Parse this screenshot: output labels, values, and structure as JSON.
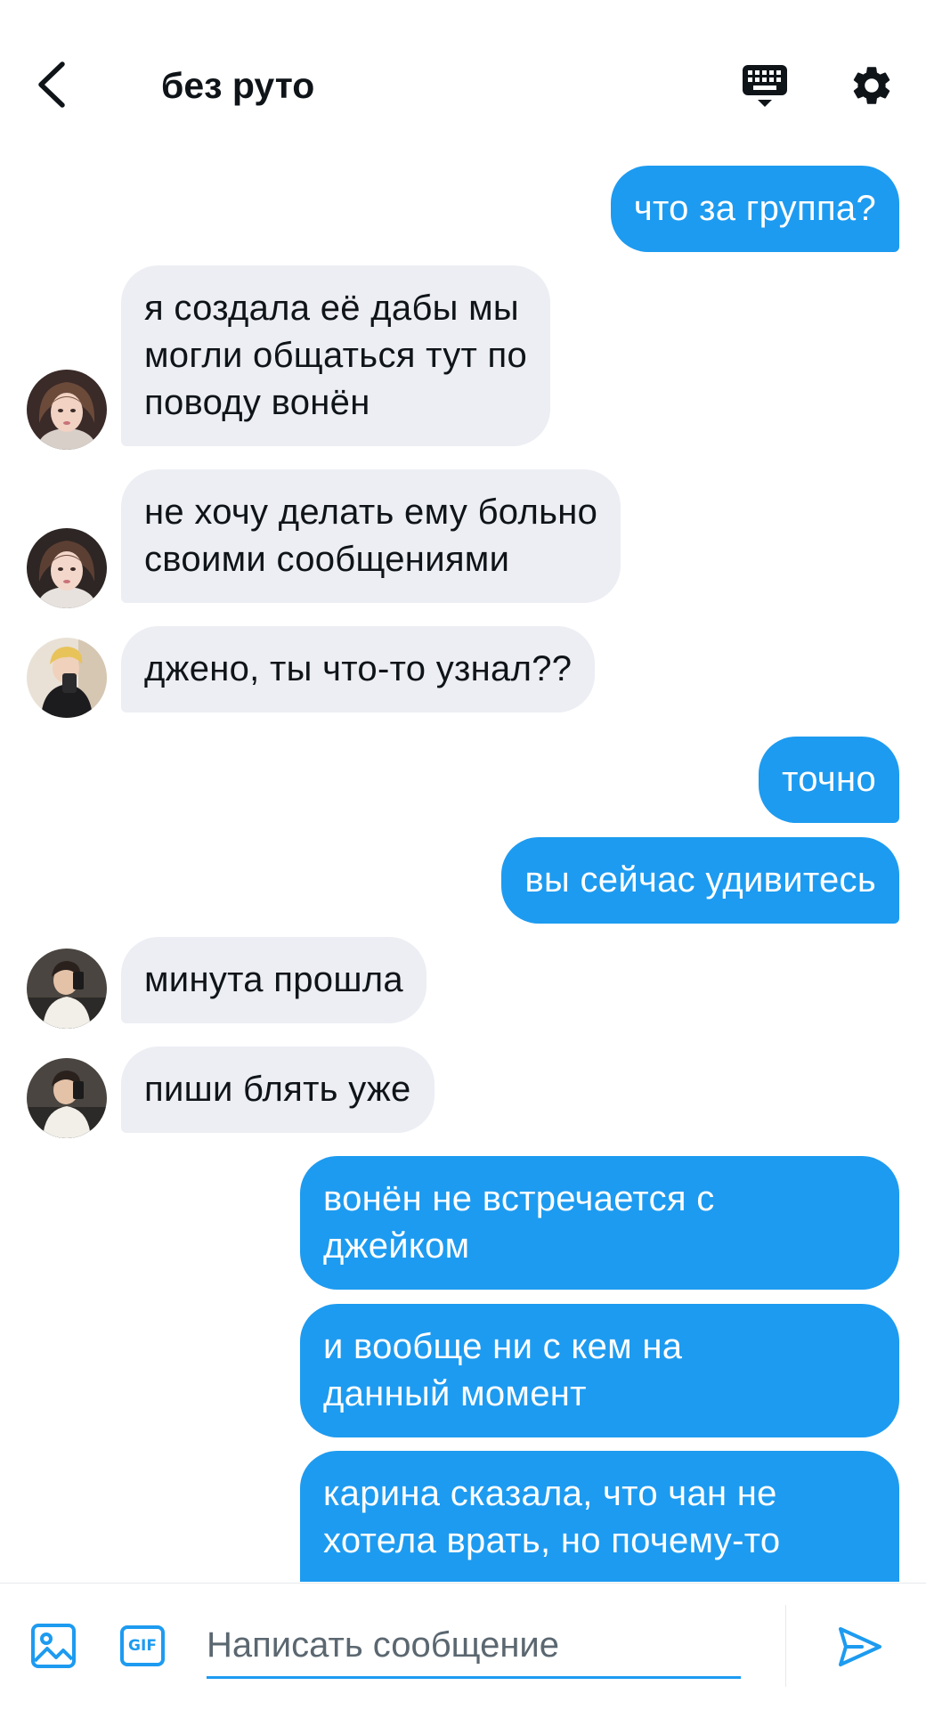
{
  "header": {
    "title": "без руто",
    "back_icon": "chevron-left-icon",
    "keyboard_icon": "keyboard-icon",
    "settings_icon": "gear-icon"
  },
  "messages": [
    {
      "direction": "out",
      "text": "что за группа?"
    },
    {
      "direction": "in",
      "text": "я создала её дабы мы\nмогли общаться тут по\nповоду вонён"
    },
    {
      "direction": "in",
      "text": "не хочу делать ему больно\nсвоими сообщениями"
    },
    {
      "direction": "in",
      "text": "джено, ты что-то узнал??"
    },
    {
      "direction": "out",
      "text": "точно"
    },
    {
      "direction": "out",
      "text": "вы сейчас удивитесь"
    },
    {
      "direction": "in",
      "text": "минута прошла"
    },
    {
      "direction": "in",
      "text": "пиши блять уже"
    },
    {
      "direction": "out",
      "text": "вонён не встречается с\nджейком"
    },
    {
      "direction": "out",
      "text": "и вообще ни с кем на\nданный момент"
    },
    {
      "direction": "out",
      "text": "карина сказала, что чан не\nхотела врать, но почему-то"
    }
  ],
  "composer": {
    "placeholder": "Написать сообщение",
    "value": "",
    "media_icon": "image-icon",
    "gif_label": "GIF",
    "send_icon": "send-icon"
  },
  "colors": {
    "accent": "#1d9bf0",
    "incoming_bubble": "#eceef3",
    "text": "#0f1419"
  }
}
